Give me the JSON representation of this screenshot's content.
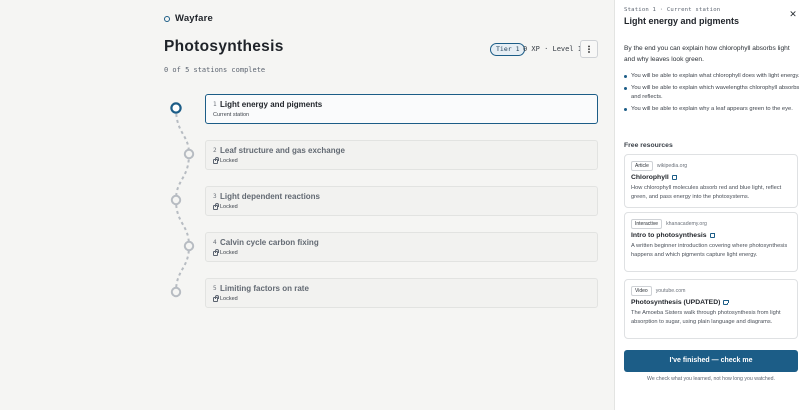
{
  "brand": {
    "name": "Wayfare"
  },
  "page": {
    "title": "Photosynthesis",
    "progress": "0 of 5 stations complete",
    "stations_total": 5,
    "stations_complete": 0
  },
  "header": {
    "tier": "Tier 1",
    "xp": "0 XP · Level 1",
    "more_icon": "vertical-dots-icon"
  },
  "stations": [
    {
      "num": "1",
      "title": "Light energy and pigments",
      "status": "Current station",
      "state": "current"
    },
    {
      "num": "2",
      "title": "Leaf structure and gas exchange",
      "status": "Locked",
      "state": "locked"
    },
    {
      "num": "3",
      "title": "Light dependent reactions",
      "status": "Locked",
      "state": "locked"
    },
    {
      "num": "4",
      "title": "Calvin cycle carbon fixing",
      "status": "Locked",
      "state": "locked"
    },
    {
      "num": "5",
      "title": "Limiting factors on rate",
      "status": "Locked",
      "state": "locked"
    }
  ],
  "panel": {
    "eyebrow": "Station 1 · Current station",
    "title": "Light energy and pigments",
    "close_icon": "close-icon",
    "intro": "By the end you can explain how chlorophyll absorbs light and why leaves look green.",
    "outcomes": [
      "You will be able to explain what chlorophyll does with light energy.",
      "You will be able to explain which wavelengths chlorophyll absorbs and reflects.",
      "You will be able to explain why a leaf appears green to the eye."
    ],
    "resources_heading": "Free resources",
    "resources": [
      {
        "tag": "Article",
        "host": "wikipedia.org",
        "title": "Chlorophyll",
        "desc": "How chlorophyll molecules absorb red and blue light, reflect green, and pass energy into the photosystems."
      },
      {
        "tag": "Interactive",
        "host": "khanacademy.org",
        "title": "Intro to photosynthesis",
        "desc": "A written beginner introduction covering where photosynthesis happens and which pigments capture light energy."
      },
      {
        "tag": "Video",
        "host": "youtube.com",
        "title": "Photosynthesis (UPDATED)",
        "desc": "The Amoeba Sisters walk through photosynthesis from light absorption to sugar, using plain language and diagrams."
      }
    ],
    "finish_label": "I've finished — check me",
    "finish_note": "We check what you learned, not how long you watched."
  },
  "colors": {
    "accent": "#1c5d87",
    "path": "#b7bcc2"
  }
}
